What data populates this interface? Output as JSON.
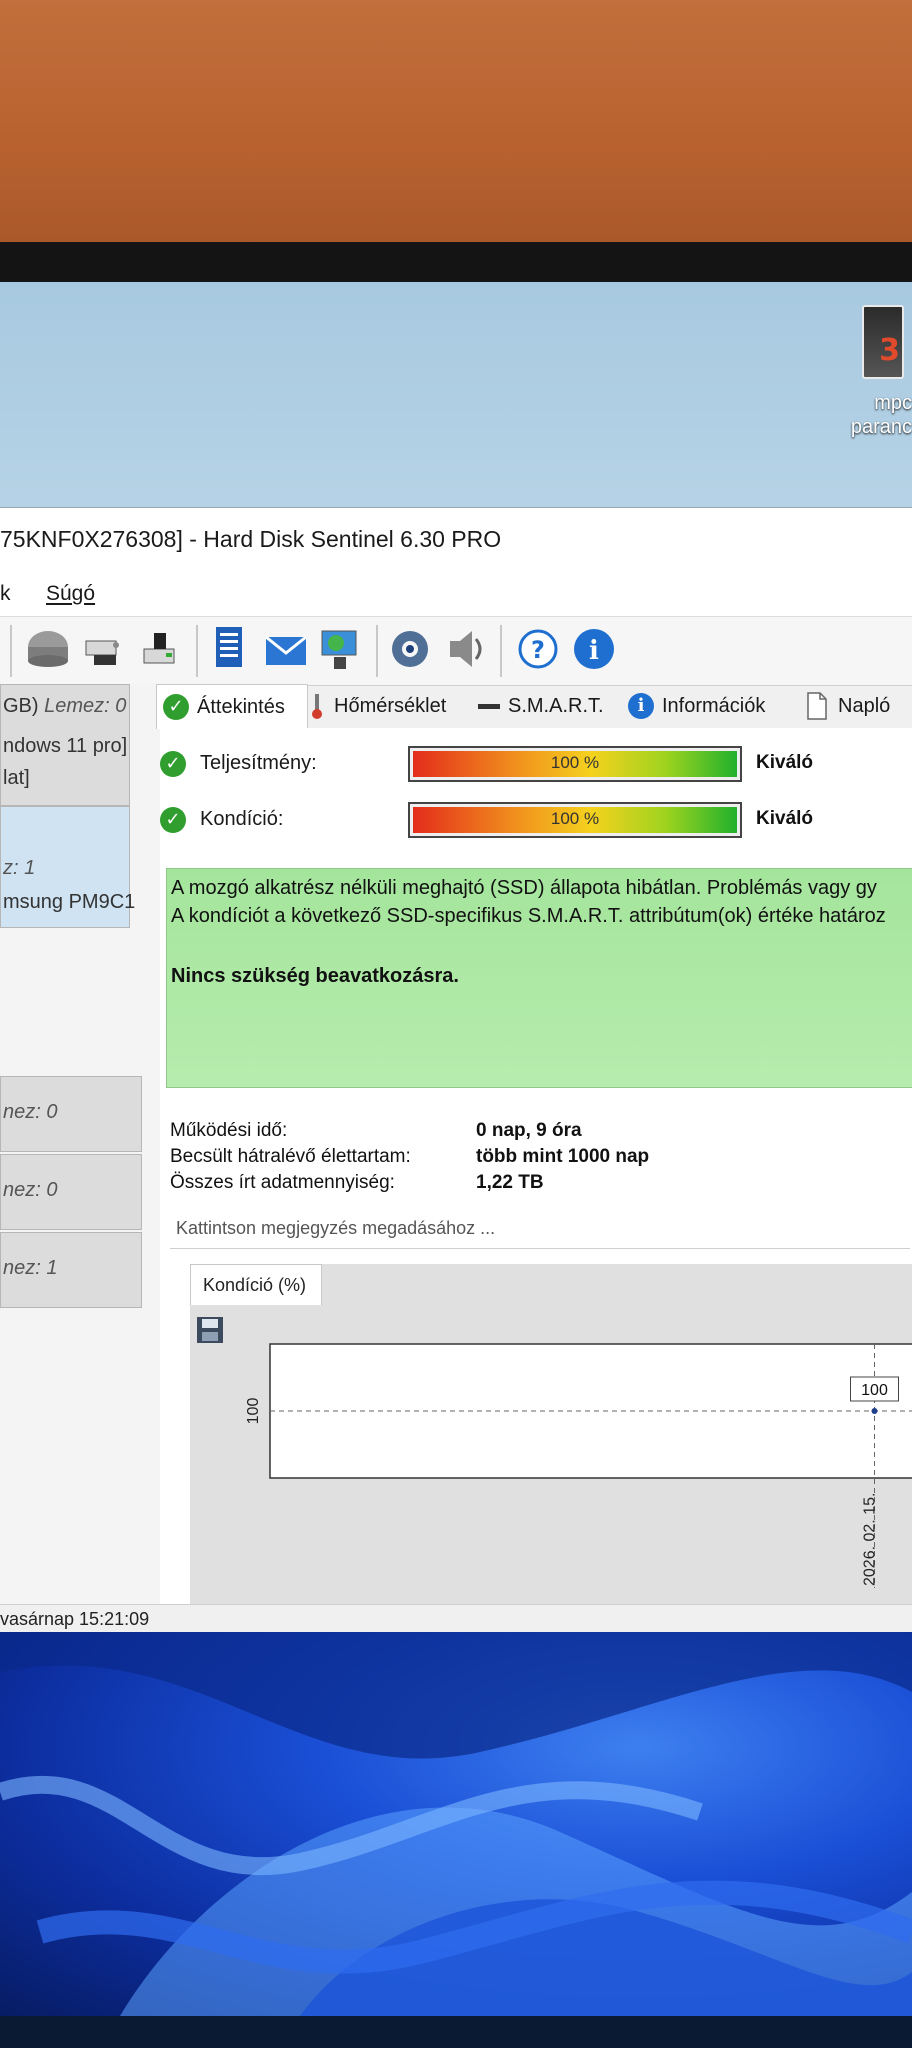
{
  "desktop": {
    "shortcut": {
      "glyph": "3",
      "label_line1": "mpc",
      "label_line2": "paranc",
      "icon": "film-clapper-shortcut-icon"
    }
  },
  "window": {
    "title": "75KNF0X276308]  -  Hard Disk Sentinel 6.30 PRO"
  },
  "menu": {
    "items": [
      "k",
      "Súgó"
    ]
  },
  "toolbar": {
    "icons": [
      "disk-icon",
      "drive-network-icon",
      "drive-usb-icon",
      "report-icon",
      "email-icon",
      "network-monitor-icon",
      "settings-gear-icon",
      "sound-icon",
      "help-icon",
      "info-icon"
    ]
  },
  "sidebar": {
    "disk1": {
      "line1_prefix": "GB)",
      "line1_italic": "Lemez: 0",
      "line2": "ndows 11 pro]",
      "line3": "lat]"
    },
    "disk2": {
      "line1_italic": "z: 1",
      "line2": "msung PM9C1"
    },
    "disk3": {
      "line1_italic": "nez: 0"
    },
    "disk4": {
      "line1_italic": "nez: 0"
    },
    "disk5": {
      "line1_italic": "nez: 1"
    }
  },
  "tabs": [
    {
      "label": "Áttekintés",
      "icon": "check-icon"
    },
    {
      "label": "Hőmérséklet",
      "icon": "thermometer-icon"
    },
    {
      "label": "S.M.A.R.T.",
      "icon": "smart-bar-icon"
    },
    {
      "label": "Információk",
      "icon": "info-icon"
    },
    {
      "label": "Napló",
      "icon": "document-icon"
    }
  ],
  "overview": {
    "performance": {
      "label": "Teljesítmény:",
      "value": "100 %",
      "fraction": 1.0,
      "grade": "Kiváló"
    },
    "health": {
      "label": "Kondíció:",
      "value": "100 %",
      "fraction": 1.0,
      "grade": "Kiváló"
    },
    "status": {
      "line1": "A mozgó alkatrész nélküli meghajtó (SSD) állapota hibátlan. Problémás vagy gy",
      "line2": "A kondíciót a következő SSD-specifikus S.M.A.R.T. attribútum(ok) értéke határoz",
      "line3": "Nincs szükség beavatkozásra."
    },
    "details": [
      {
        "key": "Működési idő:",
        "value": "0 nap, 9 óra"
      },
      {
        "key": "Becsült hátralévő élettartam:",
        "value": "több mint 1000 nap"
      },
      {
        "key": "Összes írt adatmennyiség:",
        "value": "1,22 TB"
      }
    ],
    "note_placeholder": "Kattintson megjegyzés megadásához ..."
  },
  "chart_data": {
    "type": "line",
    "title": "Kondíció  (%)",
    "x": [
      "2026. 02. 15."
    ],
    "series": [
      {
        "values": [
          100
        ]
      }
    ],
    "y_tick_labels": [
      "100"
    ],
    "data_labels": [
      "100"
    ],
    "grid": true
  },
  "statusbar": {
    "text": "vasárnap 15:21:09"
  },
  "colors": {
    "status_box": "#a4e59c",
    "bar_low": "#e32d1c",
    "bar_high": "#21b12d",
    "check": "#2f9e2f",
    "info": "#1f6fd0",
    "wallpaper": "#1a4fd6"
  }
}
